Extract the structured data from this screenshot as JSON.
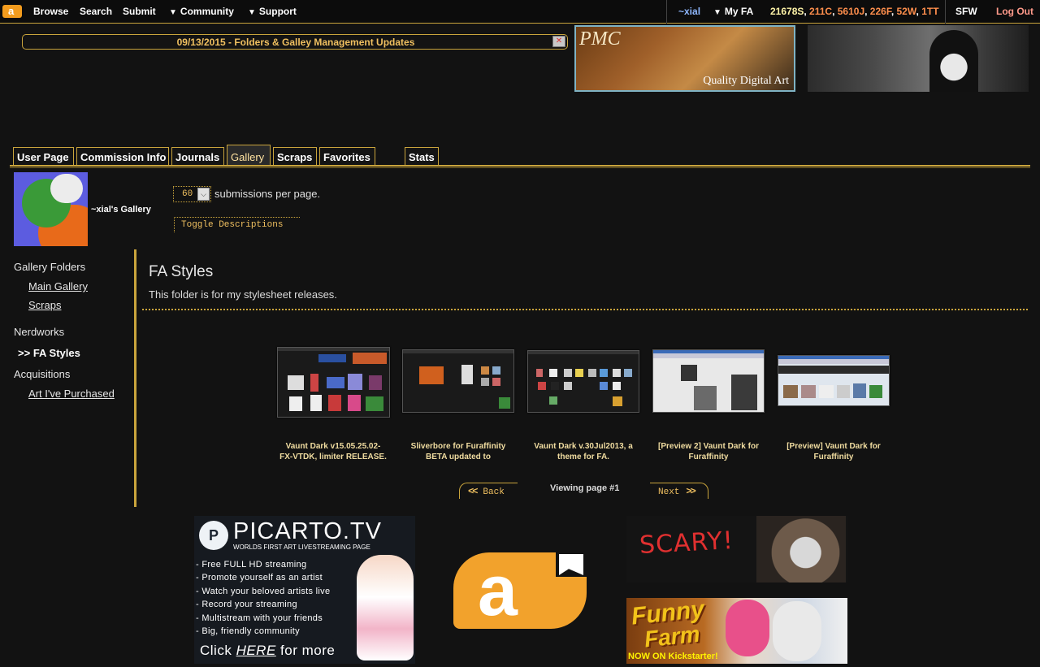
{
  "nav": {
    "logo_icon": "fa-logo-icon",
    "browse": "Browse",
    "search": "Search",
    "submit": "Submit",
    "community": "Community",
    "support": "Support",
    "dropdown_glyph": "▼",
    "user": "~xial",
    "myfa": "My FA",
    "counters": {
      "submissions": "21678S",
      "comments": "211C",
      "journals": "5610J",
      "favorites": "226F",
      "watches": "52W",
      "troubletickets": "1TT",
      "sep": ", "
    },
    "rating": "SFW",
    "logout": "Log Out"
  },
  "notice": {
    "text": "09/13/2015 - Folders & Galley Management Updates",
    "close_glyph": "✕"
  },
  "banners": {
    "pmc_name": "PMC",
    "pmc_tagline": "Quality Digital Art"
  },
  "tabs": [
    {
      "label": "User Page"
    },
    {
      "label": "Commission Info"
    },
    {
      "label": "Journals"
    },
    {
      "label": "Gallery",
      "active": true
    },
    {
      "label": "Scraps"
    },
    {
      "label": "Favorites"
    },
    {
      "label": "Stats"
    }
  ],
  "gallery": {
    "title": "~xial's Gallery",
    "per_page_value": "60",
    "per_page_arrow": "⌵",
    "per_page_text": "submissions per page.",
    "toggle_descriptions": "Toggle Descriptions"
  },
  "sidebar": {
    "gallery_folders": "Gallery Folders",
    "main_gallery": "Main Gallery",
    "scraps": "Scraps",
    "nerdworks": "Nerdworks",
    "active_marker": ">>",
    "fa_styles": "FA Styles",
    "acquisitions": "Acquisitions",
    "art_purchased": "Art I've Purchased"
  },
  "folder": {
    "title": "FA Styles",
    "description": "This folder is for my stylesheet releases."
  },
  "submissions": [
    {
      "line1": "Vaunt Dark v15.05.25.02-",
      "line2": "FX-VTDK, limiter RELEASE."
    },
    {
      "line1": "Sliverbore for Furaffinity",
      "line2": "BETA updated to"
    },
    {
      "line1": "Vaunt Dark v.30Jul2013, a",
      "line2": "theme for FA."
    },
    {
      "line1": "[Preview 2] Vaunt Dark for",
      "line2": "Furaffinity"
    },
    {
      "line1": "[Preview] Vaunt Dark for",
      "line2": "Furaffinity"
    }
  ],
  "pagination": {
    "back": "Back",
    "next": "Next",
    "back_glyph": "<<",
    "next_glyph": ">>",
    "viewing": "Viewing page #1"
  },
  "ads": {
    "picarto": {
      "logo_letter": "P",
      "brand": "PICARTO.TV",
      "tagline": "WORLDS FIRST ART LIVESTREAMING PAGE",
      "bullets": [
        "- Free FULL HD streaming",
        "- Promote yourself as an artist",
        "- Watch your beloved artists live",
        "- Record your streaming",
        "- Multistream with your friends",
        "- Big, friendly community"
      ],
      "cta_pre": "Click ",
      "cta_link": "HERE",
      "cta_post": " for more"
    },
    "fa_logo_letter": "a",
    "scary": "SCARY!",
    "funny_line1": "Funny",
    "funny_line2": "Farm",
    "funny_sub": "NOW ON Kickstarter!"
  },
  "colors": {
    "accent": "#c9a43c",
    "background": "#121212",
    "fa_orange": "#f39c1e"
  }
}
